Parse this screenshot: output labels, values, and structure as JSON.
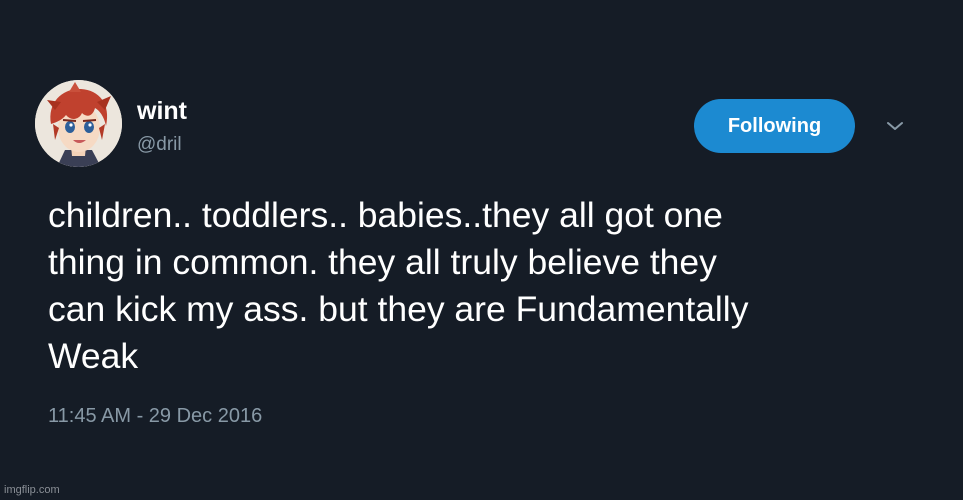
{
  "user": {
    "display_name": "wint",
    "handle": "@dril"
  },
  "follow_button": {
    "label": "Following"
  },
  "menu": {
    "icon": "chevron-down-icon"
  },
  "tweet": {
    "lines": [
      "children.. toddlers.. babies..they all got one",
      "thing in common. they all truly believe they",
      "can kick my ass. but they are Fundamentally",
      "Weak"
    ],
    "timestamp": "11:45 AM - 29 Dec 2016"
  },
  "watermark": {
    "text": "imgflip.com"
  },
  "colors": {
    "background": "#151c26",
    "accent": "#1c8ad1",
    "secondary_text": "#8899a6"
  }
}
